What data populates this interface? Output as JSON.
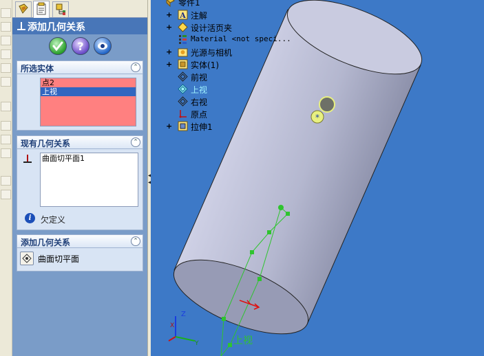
{
  "property_manager": {
    "title": "添加几何关系",
    "buttons": {
      "ok": "ok-check",
      "help": "help-question",
      "pushpin": "keep-visible"
    },
    "selected_entities": {
      "header": "所选实体",
      "items": [
        {
          "label": "点2",
          "selected": false
        },
        {
          "label": "上视",
          "selected": true
        }
      ]
    },
    "existing_relations": {
      "header": "现有几何关系",
      "items": [
        "曲面切平面1"
      ],
      "status_icon": "info-icon",
      "status_text": "欠定义"
    },
    "add_relations": {
      "header": "添加几何关系",
      "button_label": "曲面切平面"
    }
  },
  "feature_tree": {
    "items": [
      {
        "label": "零件1",
        "icon": "part-icon",
        "expander": ""
      },
      {
        "label": "注解",
        "icon": "annotations-icon",
        "expander": "+"
      },
      {
        "label": "设计活页夹",
        "icon": "design-binder-icon",
        "expander": "+"
      },
      {
        "label": "Material <not speci...",
        "icon": "material-icon",
        "expander": ""
      },
      {
        "label": "光源与相机",
        "icon": "lights-cameras-icon",
        "expander": "+"
      },
      {
        "label": "实体(1)",
        "icon": "solid-bodies-icon",
        "expander": "+"
      },
      {
        "label": "前视",
        "icon": "plane-icon",
        "expander": ""
      },
      {
        "label": "上视",
        "icon": "plane-icon",
        "expander": "",
        "highlight": true
      },
      {
        "label": "右视",
        "icon": "plane-icon",
        "expander": ""
      },
      {
        "label": "原点",
        "icon": "origin-icon",
        "expander": ""
      },
      {
        "label": "拉伸1",
        "icon": "extrude-icon",
        "expander": "+"
      }
    ]
  },
  "viewport": {
    "plane_label": "上视",
    "triad_axes": [
      "Z",
      "X",
      "Y"
    ]
  },
  "colors": {
    "background": "#3d79c7",
    "panel_title": "#4876b8",
    "selection_list": "#ff8080",
    "sketch_green": "#2fc42f",
    "plane_highlight": "#9ff2ff"
  }
}
